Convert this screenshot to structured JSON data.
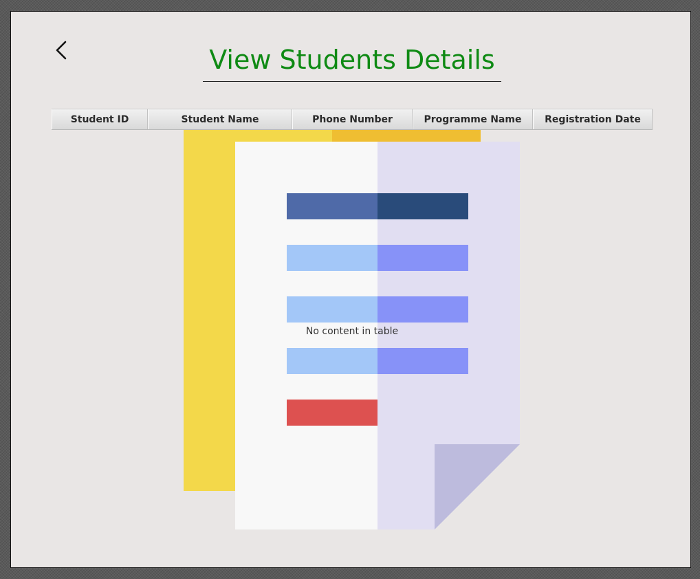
{
  "header": {
    "title": "View Students Details",
    "back_icon": "chevron-left-icon"
  },
  "table": {
    "columns": [
      "Student ID",
      "Student Name",
      "Phone Number",
      "Programme Name",
      "Registration Date"
    ],
    "rows": [],
    "placeholder": "No content in table",
    "placeholder_icon": "document-icon"
  },
  "colors": {
    "title": "#0f8a14",
    "background": "#e9e6e5",
    "doc_folder": "#f3d84a",
    "doc_folder_dark": "#efbe32",
    "doc_page_left": "#f8f8f8",
    "doc_page_right": "#e1def2",
    "doc_fold": "#bdbbdd",
    "bar_dark_left": "#4f6aa8",
    "bar_dark_right": "#294b7a",
    "bar_light_left": "#a3c7f8",
    "bar_light_right": "#8792f8",
    "bar_red": "#dd5150"
  }
}
